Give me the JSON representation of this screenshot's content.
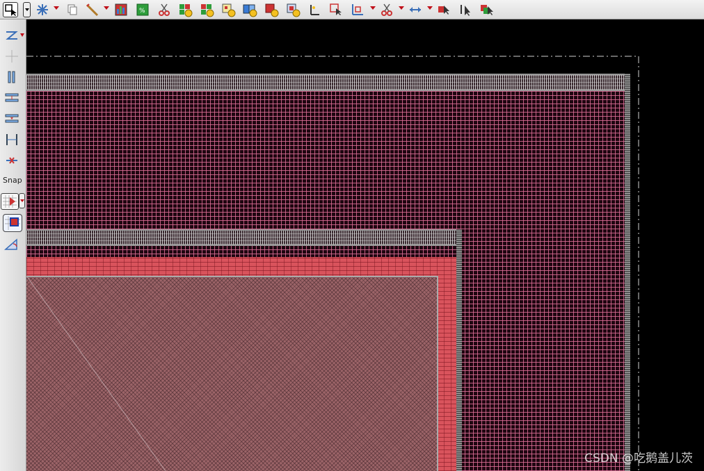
{
  "sidebar": {
    "snap_label": "Snap"
  },
  "watermark": "CSDN @吃鹅盖儿茨",
  "colors": {
    "toolbar_bg": "#e6e6e6",
    "canvas_bg": "#000000",
    "grid_pink": "#dc6e96",
    "brick_red": "#d9535c",
    "mesh_mauve": "#9c6468",
    "dropdown_arrow": "#c0101a"
  },
  "toolbar": {
    "icons": [
      "select-arrow-icon",
      "snowflake-icon",
      "copy-icon",
      "wand-icon",
      "chart-icon",
      "green-square-icon",
      "scissors-icon",
      "add-green-icon",
      "add-green-red-icon",
      "add-square-icon",
      "add-book-icon",
      "add-red-icon",
      "add-blue-icon",
      "ruler-pencil-icon",
      "select-box-icon",
      "stretch-icon",
      "cut-icon",
      "move-arrows-icon",
      "red-pointer-icon",
      "pointer-select-icon",
      "pointer-move-icon"
    ]
  },
  "sidebar_icons": [
    "flip-icon",
    "center-icon",
    "vertical-align-icon",
    "horizontal-align-top-icon",
    "horizontal-align-bottom-icon",
    "distribute-icon",
    "delete-align-icon",
    "snap-grid-icon",
    "snap-box-icon",
    "snap-angle-icon"
  ]
}
